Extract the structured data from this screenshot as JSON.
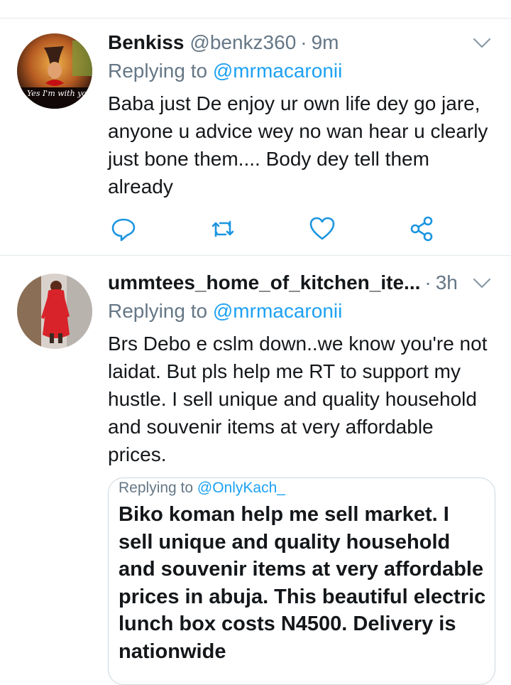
{
  "tweets": [
    {
      "name": "Benkiss",
      "handle": "@benkz360",
      "separator": "·",
      "time": "9m",
      "replying_prefix": "Replying to ",
      "replying_to": "@mrmacaronii",
      "text": "Baba just De enjoy ur own life dey go jare, anyone u advice wey no wan hear u clearly just bone them.... Body dey tell them already",
      "avatar_caption": "Yes I'm with you forever",
      "actions": [
        "reply-icon",
        "retweet-icon",
        "like-icon",
        "share-icon"
      ]
    },
    {
      "name": "ummtees_home_of_kitchen_ite...",
      "separator": "·",
      "time": "3h",
      "replying_prefix": "Replying to ",
      "replying_to": "@mrmacaronii",
      "text": "Brs Debo e cslm down..we know you're not laidat. But pls help me RT to support my hustle.  I sell unique and quality household and souvenir items at very affordable prices.",
      "quote": {
        "replying_prefix": "Replying to ",
        "replying_to": "@OnlyKach_",
        "text": "Biko koman help me sell market. I sell unique and quality household and souvenir items at very affordable prices in abuja.  This beautiful electric lunch box costs N4500.  Delivery is nationwide"
      }
    }
  ],
  "colors": {
    "text": "#14171a",
    "secondary": "#657786",
    "link": "#1da1f2",
    "divider": "#e1e8ed",
    "icon": "#1b95e0"
  }
}
